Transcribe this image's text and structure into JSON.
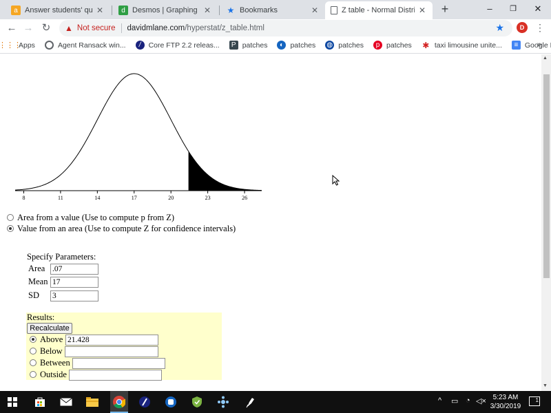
{
  "browser": {
    "tabs": [
      {
        "label": "Answer students' questio",
        "icon": "chegg-icon",
        "active": false
      },
      {
        "label": "Desmos | Graphing Calcu",
        "icon": "desmos-icon",
        "active": false
      },
      {
        "label": "Bookmarks",
        "icon": "star-icon",
        "active": false
      },
      {
        "label": "Z table - Normal Distribu",
        "icon": "page-icon",
        "active": true
      }
    ],
    "new_tab_glyph": "+",
    "window_controls": {
      "minimize": "–",
      "restore": "❐",
      "close": "✕"
    },
    "nav": {
      "back": "←",
      "forward": "→",
      "reload": "↻"
    },
    "address": {
      "security_label": "Not secure",
      "host": "davidmlane.com",
      "path": "/hyperstat/z_table.html"
    },
    "profile_initial": "D",
    "bookmarks": [
      {
        "label": "Apps",
        "icon": "apps-icon"
      },
      {
        "label": "Agent Ransack win...",
        "icon": "agent-ransack-icon"
      },
      {
        "label": "Core FTP 2.2 releas...",
        "icon": "core-ftp-icon"
      },
      {
        "label": "patches",
        "icon": "patches-icon"
      },
      {
        "label": "patches",
        "icon": "patches-icon"
      },
      {
        "label": "patches",
        "icon": "patches-icon"
      },
      {
        "label": "patches",
        "icon": "patches-icon"
      },
      {
        "label": "taxi limousine unite...",
        "icon": "yelp-icon"
      },
      {
        "label": "Google News",
        "icon": "google-news-icon"
      }
    ],
    "bookmarks_more": "»"
  },
  "page": {
    "chart_data": {
      "type": "area",
      "title": "",
      "distribution": "normal",
      "mean": 17,
      "sd": 3,
      "x_ticks": [
        "8",
        "11",
        "14",
        "17",
        "20",
        "23",
        "26"
      ],
      "xlim": [
        7.3,
        27.4
      ],
      "shaded_region": {
        "type": "above",
        "from": 21.428
      }
    },
    "mode_options": [
      {
        "label": "Area from a value (Use to compute p from Z)",
        "checked": false
      },
      {
        "label": "Value from an area (Use to compute Z for confidence intervals)",
        "checked": true
      }
    ],
    "params": {
      "heading": "Specify Parameters:",
      "area_label": "Area",
      "area_value": ".07",
      "mean_label": "Mean",
      "mean_value": "17",
      "sd_label": "SD",
      "sd_value": "3"
    },
    "results": {
      "heading": "Results:",
      "recalculate_label": "Recalculate",
      "options": [
        {
          "label": "Above",
          "value": "21.428",
          "checked": true
        },
        {
          "label": "Below",
          "value": "",
          "checked": false
        },
        {
          "label": "Between",
          "value": "",
          "checked": false
        },
        {
          "label": "Outside",
          "value": "",
          "checked": false
        }
      ]
    }
  },
  "taskbar": {
    "clock_time": "5:23 AM",
    "clock_date": "3/30/2019",
    "notification_count": "1"
  }
}
